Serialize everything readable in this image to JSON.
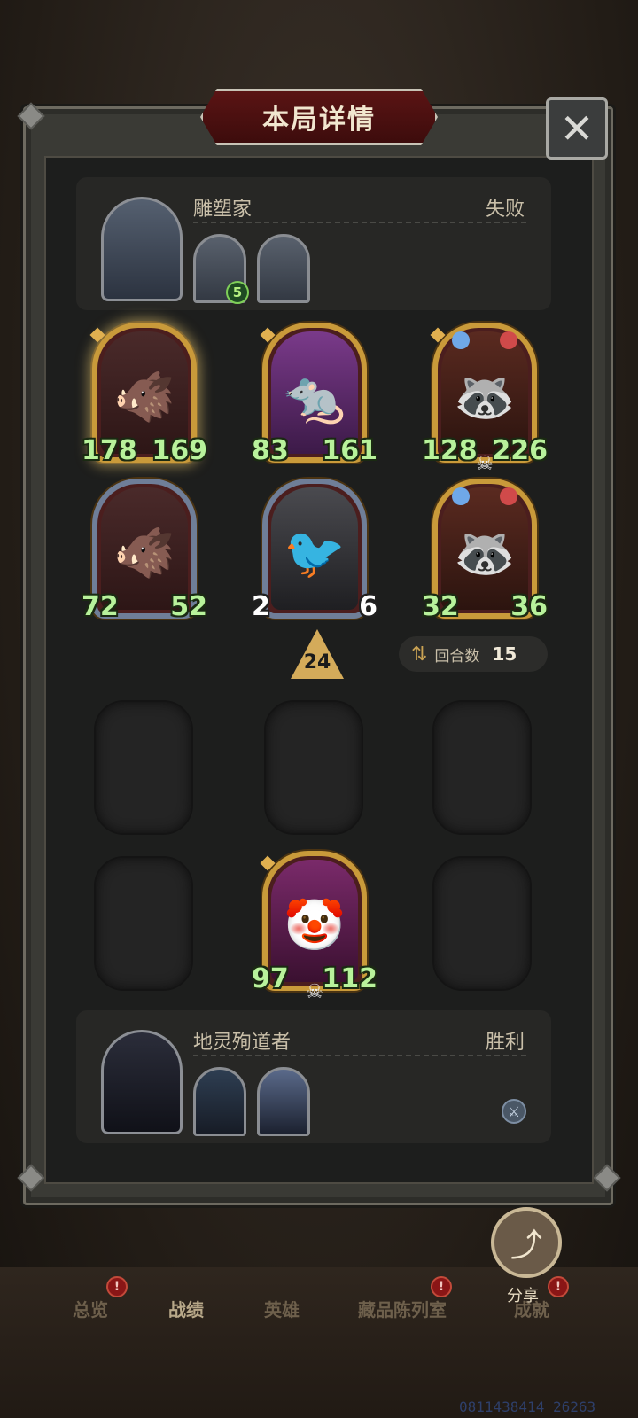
{
  "title": "本局详情",
  "close_icon": "close-icon",
  "player_top": {
    "name": "雕塑家",
    "result": "失败",
    "mini_badge": "5"
  },
  "board_top": [
    {
      "atk": "178",
      "hp": "169",
      "creature": "boar"
    },
    {
      "atk": "83",
      "hp": "161",
      "creature": "rat"
    },
    {
      "atk": "128",
      "hp": "226",
      "creature": "racoon"
    },
    {
      "atk": "72",
      "hp": "52",
      "creature": "boar"
    },
    {
      "atk": "2",
      "hp": "6",
      "creature": "plague-doctor"
    },
    {
      "atk": "32",
      "hp": "36",
      "creature": "racoon"
    }
  ],
  "tier": "24",
  "rounds": {
    "label": "回合数",
    "value": "15"
  },
  "board_bottom": [
    {
      "atk": "97",
      "hp": "112",
      "creature": "clown"
    }
  ],
  "player_bottom": {
    "name": "地灵殉道者",
    "result": "胜利"
  },
  "nav": {
    "overview": "总览",
    "records": "战绩",
    "heroes": "英雄",
    "collection": "藏品陈列室",
    "achievements": "成就",
    "alert": "!"
  },
  "share_label": "分享",
  "watermark": "0811438414 26263",
  "colors": {
    "gold_frame": "#c99a3a",
    "silver_frame": "#6f7e98",
    "stat_green": "#b8f29b",
    "banner_red": "#5a1414"
  }
}
